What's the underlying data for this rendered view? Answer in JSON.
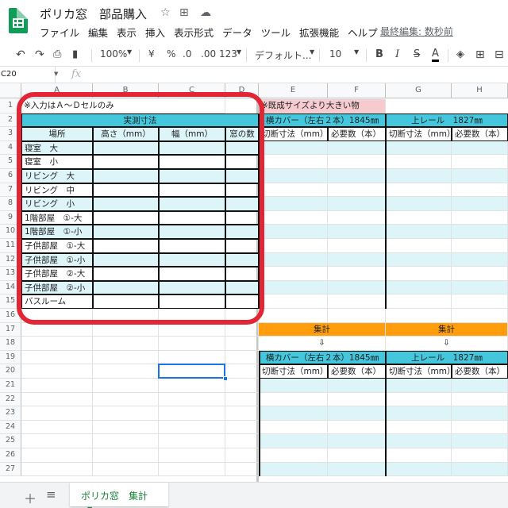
{
  "header": {
    "doc_title": "ポリカ窓　部品購入",
    "star_icon": "star-icon",
    "menu": [
      "ファイル",
      "編集",
      "表示",
      "挿入",
      "表示形式",
      "データ",
      "ツール",
      "拡張機能",
      "ヘルプ"
    ],
    "last_edit": "最終編集: 数秒前"
  },
  "toolbar": {
    "zoom": "100%",
    "currency": "¥",
    "percent": "%",
    "dec_less": ".0",
    "dec_more": ".00",
    "format_123": "123",
    "font": "デフォルト...",
    "font_size": "10",
    "bold": "B",
    "italic": "I",
    "strike": "S",
    "text_color": "A"
  },
  "formula_bar": {
    "name_box": "C20",
    "fx": "fx"
  },
  "columns": [
    "",
    "A",
    "B",
    "C",
    "D",
    "E",
    "F",
    "G",
    "H"
  ],
  "rows": [
    "1",
    "2",
    "3",
    "4",
    "5",
    "6",
    "7",
    "8",
    "9",
    "10",
    "11",
    "12",
    "13",
    "14",
    "15",
    "16",
    "17",
    "18",
    "19",
    "20",
    "21",
    "22",
    "23",
    "24",
    "25",
    "26",
    "27"
  ],
  "left_table": {
    "note": "※入力はＡ～Ｄセルのみ",
    "header": "実測寸法",
    "cols": [
      "場所",
      "高さ（mm）",
      "幅（mm）",
      "窓の数"
    ],
    "places": [
      "寝室　大",
      "寝室　小",
      "リビング　大",
      "リビング　中",
      "リビング　小",
      "1階部屋　①-大",
      "1階部屋　①-小",
      "子供部屋　①-大",
      "子供部屋　①-小",
      "子供部屋　②-大",
      "子供部屋　②-小",
      "バスルーム"
    ]
  },
  "right_table": {
    "note": "※既成サイズより大きい物",
    "group1": "横カバー（左右２本）1845㎜",
    "group2": "上レール　1827㎜",
    "sub1": "切断寸法（mm）",
    "sub2": "必要数（本）",
    "total_label": "集計",
    "arrow": "⇩"
  },
  "sheets": {
    "active": "ポリカ窓　集計"
  },
  "colors": {
    "cyan": "#44c7dc",
    "light": "#ddf4f9",
    "orange": "#ff9d0d",
    "pink": "#f6cbd0",
    "red": "#e32636"
  }
}
